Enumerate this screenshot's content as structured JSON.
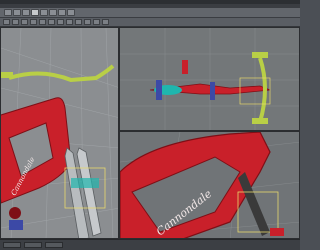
{
  "app": {
    "title": ""
  },
  "menu": {
    "items": []
  },
  "tabs": [],
  "viewports": {
    "left": {
      "label": ""
    },
    "top": {
      "label": ""
    },
    "perspective": {
      "label": ""
    }
  },
  "model": {
    "frame_brand_text": "Cannondale",
    "colors": {
      "frame": "#c9202a",
      "frame_dark": "#7e0f16",
      "fork": "#b8bcbf",
      "handlebar": "#b9cf46",
      "accent_blue": "#3c49a6",
      "accent_cyan": "#1fb6ae",
      "selection": "#e6d86d",
      "grid_bg_left": "#8b8e91",
      "grid_bg_right": "#737779",
      "grid_line": "#9da1a4"
    }
  },
  "status": {
    "text": ""
  }
}
